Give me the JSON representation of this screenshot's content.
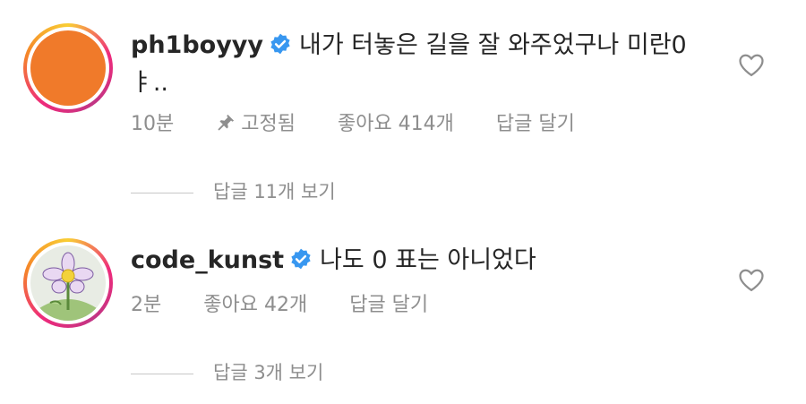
{
  "comments": [
    {
      "username": "ph1boyyy",
      "text": "내가 터놓은 길을 잘 와주었구나 미란0ㅑ..",
      "time": "10분",
      "pinned_label": "고정됨",
      "likes": "좋아요 414개",
      "reply_label": "답글 달기",
      "view_replies": "답글 11개 보기"
    },
    {
      "username": "code_kunst",
      "text": "나도 0 표는 아니었다",
      "time": "2분",
      "likes": "좋아요 42개",
      "reply_label": "답글 달기",
      "view_replies": "답글 3개 보기"
    }
  ],
  "icons": {
    "verified": "verified-badge-icon",
    "pin": "pin-icon",
    "like": "heart-outline-icon"
  },
  "colors": {
    "verified": "#3897f0",
    "meta": "#8e8e8e",
    "avatar1": "#f07a2a"
  }
}
